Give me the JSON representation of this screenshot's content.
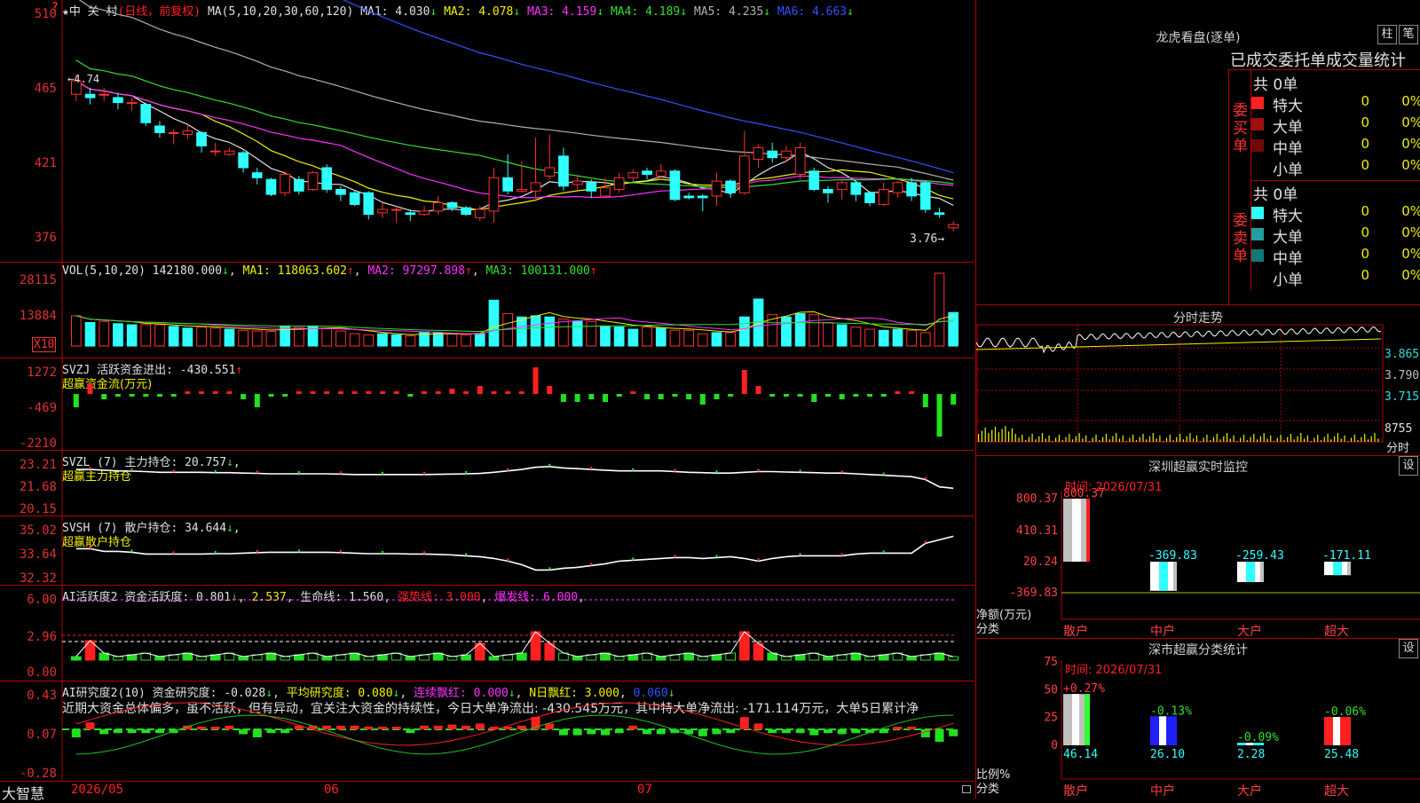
{
  "stock": {
    "title": "★中 关 村",
    "mode": "(日线，前复权)",
    "ma_label": "MA(5,10,20,30,60,120)",
    "ma": [
      {
        "label": "MA1: 4.030",
        "color": "#e0e0e0",
        "arrow": "↓"
      },
      {
        "label": "MA2: 4.078",
        "color": "#f0f000",
        "arrow": "↓"
      },
      {
        "label": "MA3: 4.159",
        "color": "#ff30ff",
        "arrow": "↓"
      },
      {
        "label": "MA4: 4.189",
        "color": "#30e030",
        "arrow": "↓"
      },
      {
        "label": "MA5: 4.235",
        "color": "#b0b0b0",
        "arrow": "↓"
      },
      {
        "label": "MA6: 4.663",
        "color": "#3050ff",
        "arrow": "↓"
      }
    ],
    "y_ticks": [
      "510",
      "465",
      "421",
      "376"
    ],
    "high_label": "4.74",
    "low_label": "3.76",
    "question": "?"
  },
  "vol": {
    "label": "VOL(5,10,20)",
    "value": "142180.000",
    "ma1": "MA1: 118063.602",
    "ma2": "MA2: 97297.898",
    "ma3": "MA3: 100131.000",
    "y_ticks": [
      "28115",
      "13884"
    ],
    "unit": "X10"
  },
  "svzj": {
    "label": "SVZJ",
    "desc": "活跃资金进出: -430.551",
    "sub": "超赢资金流(万元)",
    "y_ticks": [
      "1272",
      "-469",
      "-2210"
    ]
  },
  "svzl": {
    "label": "SVZL (7)",
    "desc": "主力持仓: 20.757",
    "sub": "超赢主力持仓",
    "y_ticks": [
      "23.21",
      "21.68",
      "20.15"
    ]
  },
  "svsh": {
    "label": "SVSH (7)",
    "desc": "散户持仓: 34.644",
    "sub": "超赢散户持仓",
    "y_ticks": [
      "35.02",
      "33.64",
      "32.32"
    ]
  },
  "ai1": {
    "label": "AI活跃度2",
    "v1": "资金活跃度: 0.801",
    "v2": "2.537",
    "v3": "生命线: 1.560",
    "v4": "强势线: 3.000",
    "v5": "爆发线: 6.000",
    "y_ticks": [
      "6.00",
      "2.96",
      "0.00"
    ]
  },
  "ai2": {
    "label": "AI研究度2(10)",
    "v1": "资金研究度: -0.028",
    "v2": "平均研究度: 0.080",
    "v3": "连续飘红: 0.000",
    "v4": "N日飘红: 3.000",
    "v5": "0.060",
    "commentary": "近期大资金总体偏多，虽不活跃，但有异动，宜关注大资金的持续性，今日大单净流出: -430.545万元，其中特大单净流出: -171.114万元，大单5日累计净",
    "y_ticks": [
      "0.43",
      "0.07",
      "-0.28"
    ]
  },
  "xaxis": {
    "app": "大智慧",
    "labels": [
      "2026/05",
      "06",
      "07"
    ]
  },
  "dragon": {
    "title": "龙虎看盘(逐单)",
    "btn1": "柱",
    "btn2": "笔",
    "subtitle": "已成交委托单成交量统计",
    "buy_label": "委买单",
    "sell_label": "委卖单",
    "buy_total": "共 0单",
    "sell_total": "共 0单",
    "buy_rows": [
      {
        "name": "特大",
        "count": "0",
        "pct": "0%",
        "color": "#ff2020"
      },
      {
        "name": "大单",
        "count": "0",
        "pct": "0%",
        "color": "#a01010"
      },
      {
        "name": "中单",
        "count": "0",
        "pct": "0%",
        "color": "#700808"
      },
      {
        "name": "小单",
        "count": "0",
        "pct": "0%",
        "color": ""
      }
    ],
    "sell_rows": [
      {
        "name": "特大",
        "count": "0",
        "pct": "0%",
        "color": "#30ffff"
      },
      {
        "name": "大单",
        "count": "0",
        "pct": "0%",
        "color": "#20a0a0"
      },
      {
        "name": "中单",
        "count": "0",
        "pct": "0%",
        "color": "#107878"
      },
      {
        "name": "小单",
        "count": "0",
        "pct": "0%",
        "color": ""
      }
    ]
  },
  "intraday": {
    "title": "分时走势",
    "y_ticks": [
      "3.865",
      "3.790",
      "3.715"
    ],
    "vol_tick": "8755",
    "vol_label": "分时"
  },
  "monitor": {
    "title": "深圳超赢实时监控",
    "btn": "设",
    "time": "时间: 2026/07/31",
    "y_ticks": [
      "800.37",
      "410.31",
      "20.24",
      "-369.83"
    ],
    "ylabel1": "净额(万元)",
    "ylabel2": "分类",
    "bars": [
      {
        "cat": "散户",
        "value": 800.37,
        "label": "800.37"
      },
      {
        "cat": "中户",
        "value": -369.83,
        "label": "-369.83"
      },
      {
        "cat": "大户",
        "value": -259.43,
        "label": "-259.43"
      },
      {
        "cat": "超大",
        "value": -171.11,
        "label": "-171.11"
      }
    ]
  },
  "classstat": {
    "title": "深市超赢分类统计",
    "btn": "设",
    "time": "时间: 2026/07/31",
    "y_ticks": [
      "75",
      "50",
      "25",
      "0"
    ],
    "ylabel1": "比例%",
    "ylabel2": "分类",
    "bars": [
      {
        "cat": "散户",
        "value": 46.14,
        "label": "46.14",
        "change": "+0.27%"
      },
      {
        "cat": "中户",
        "value": 26.1,
        "label": "26.10",
        "change": "-0.13%"
      },
      {
        "cat": "大户",
        "value": 2.28,
        "label": "2.28",
        "change": "-0.09%"
      },
      {
        "cat": "超大",
        "value": 25.48,
        "label": "25.48",
        "change": "-0.06%"
      }
    ]
  },
  "chart_data": {
    "type": "candlestick",
    "ylim": [
      3.76,
      5.1
    ],
    "candles": [
      [
        4.62,
        4.7,
        4.74,
        4.58
      ],
      [
        4.62,
        4.6,
        4.66,
        4.56
      ],
      [
        4.62,
        4.62,
        4.66,
        4.58
      ],
      [
        4.6,
        4.57,
        4.63,
        4.53
      ],
      [
        4.57,
        4.57,
        4.6,
        4.52
      ],
      [
        4.56,
        4.45,
        4.57,
        4.43
      ],
      [
        4.43,
        4.39,
        4.46,
        4.36
      ],
      [
        4.39,
        4.39,
        4.41,
        4.32
      ],
      [
        4.38,
        4.4,
        4.44,
        4.35
      ],
      [
        4.39,
        4.31,
        4.4,
        4.27
      ],
      [
        4.28,
        4.28,
        4.33,
        4.25
      ],
      [
        4.26,
        4.28,
        4.3,
        4.25
      ],
      [
        4.27,
        4.18,
        4.28,
        4.15
      ],
      [
        4.15,
        4.12,
        4.18,
        4.08
      ],
      [
        4.11,
        4.02,
        4.12,
        4.01
      ],
      [
        4.03,
        4.14,
        4.16,
        4.01
      ],
      [
        4.11,
        4.04,
        4.13,
        4.02
      ],
      [
        4.05,
        4.15,
        4.16,
        4.04
      ],
      [
        4.18,
        4.05,
        4.2,
        4.03
      ],
      [
        4.05,
        4.02,
        4.07,
        3.98
      ],
      [
        4.03,
        3.96,
        4.04,
        3.95
      ],
      [
        4.03,
        3.9,
        4.04,
        3.87
      ],
      [
        3.91,
        3.93,
        3.97,
        3.88
      ],
      [
        3.93,
        3.93,
        3.95,
        3.85
      ],
      [
        3.91,
        3.9,
        3.93,
        3.86
      ],
      [
        3.9,
        3.92,
        3.95,
        3.89
      ],
      [
        3.92,
        3.97,
        4.01,
        3.9
      ],
      [
        3.97,
        3.94,
        3.98,
        3.92
      ],
      [
        3.94,
        3.9,
        3.95,
        3.89
      ],
      [
        3.88,
        3.93,
        3.95,
        3.86
      ],
      [
        3.92,
        4.12,
        4.18,
        3.85
      ],
      [
        4.12,
        4.04,
        4.26,
        4.02
      ],
      [
        4.04,
        4.05,
        4.22,
        4.03
      ],
      [
        4.04,
        4.09,
        4.36,
        4.0
      ],
      [
        4.13,
        4.18,
        4.38,
        4.11
      ],
      [
        4.25,
        4.07,
        4.3,
        4.04
      ],
      [
        4.08,
        4.1,
        4.13,
        4.05
      ],
      [
        4.09,
        4.04,
        4.11,
        4.0
      ],
      [
        4.01,
        4.06,
        4.12,
        4.0
      ],
      [
        4.05,
        4.12,
        4.15,
        4.03
      ],
      [
        4.12,
        4.15,
        4.17,
        4.1
      ],
      [
        4.16,
        4.14,
        4.18,
        4.11
      ],
      [
        4.13,
        4.16,
        4.2,
        4.12
      ],
      [
        4.16,
        3.99,
        4.17,
        3.98
      ],
      [
        4.01,
        4.0,
        4.03,
        3.99
      ],
      [
        4.01,
        4.0,
        4.02,
        3.92
      ],
      [
        4.01,
        4.1,
        4.15,
        3.95
      ],
      [
        4.1,
        4.03,
        4.11,
        4.0
      ],
      [
        4.03,
        4.25,
        4.4,
        4.02
      ],
      [
        4.23,
        4.3,
        4.32,
        4.18
      ],
      [
        4.28,
        4.24,
        4.33,
        4.21
      ],
      [
        4.24,
        4.28,
        4.31,
        4.21
      ],
      [
        4.14,
        4.3,
        4.33,
        4.11
      ],
      [
        4.16,
        4.05,
        4.18,
        4.04
      ],
      [
        4.05,
        4.03,
        4.07,
        3.97
      ],
      [
        4.05,
        4.09,
        4.11,
        3.99
      ],
      [
        4.09,
        4.02,
        4.1,
        3.98
      ],
      [
        4.03,
        3.97,
        4.04,
        3.95
      ],
      [
        3.96,
        4.05,
        4.09,
        3.95
      ],
      [
        4.03,
        4.09,
        4.1,
        4.0
      ],
      [
        4.09,
        4.01,
        4.12,
        3.98
      ],
      [
        4.09,
        3.93,
        4.1,
        3.91
      ],
      [
        3.91,
        3.9,
        3.94,
        3.88
      ],
      [
        3.82,
        3.84,
        3.86,
        3.8
      ]
    ],
    "volume": [
      0.54,
      0.42,
      0.44,
      0.4,
      0.38,
      0.38,
      0.38,
      0.35,
      0.32,
      0.34,
      0.32,
      0.3,
      0.28,
      0.27,
      0.26,
      0.36,
      0.33,
      0.36,
      0.31,
      0.27,
      0.22,
      0.2,
      0.22,
      0.2,
      0.18,
      0.25,
      0.24,
      0.22,
      0.2,
      0.22,
      0.82,
      0.58,
      0.52,
      0.54,
      0.52,
      0.48,
      0.44,
      0.44,
      0.36,
      0.34,
      0.3,
      0.34,
      0.32,
      0.28,
      0.28,
      0.22,
      0.24,
      0.24,
      0.52,
      0.84,
      0.56,
      0.52,
      0.58,
      0.56,
      0.42,
      0.38,
      0.34,
      0.3,
      0.28,
      0.3,
      0.28,
      0.24,
      1.3,
      0.6
    ],
    "vol_up": [
      true,
      false,
      true,
      false,
      false,
      true,
      true,
      false,
      false,
      true,
      true,
      false,
      true,
      true,
      true,
      false,
      true,
      false,
      true,
      true,
      true,
      true,
      false,
      false,
      true,
      false,
      false,
      true,
      true,
      false,
      false,
      true,
      false,
      false,
      false,
      true,
      false,
      true,
      false,
      false,
      false,
      true,
      false,
      true,
      true,
      true,
      false,
      true,
      false,
      false,
      true,
      false,
      false,
      true,
      true,
      false,
      true,
      true,
      false,
      false,
      true,
      true,
      true,
      false
    ],
    "svzj": [
      -0.5,
      0.4,
      -0.2,
      -0.1,
      -0.1,
      -0.1,
      -0.1,
      -0.1,
      0.1,
      0.0,
      0.0,
      0.1,
      -0.2,
      -0.5,
      -0.1,
      -0.1,
      0.1,
      0.1,
      0.1,
      0.1,
      0.1,
      0.0,
      0.0,
      0.0,
      -0.1,
      0.1,
      0.1,
      0.2,
      0.1,
      0.3,
      0.0,
      0.0,
      0.1,
      1.0,
      0.3,
      -0.3,
      -0.3,
      -0.2,
      -0.3,
      -0.1,
      0.1,
      -0.2,
      -0.2,
      -0.1,
      -0.2,
      -0.4,
      -0.2,
      -0.1,
      0.9,
      0.3,
      -0.1,
      -0.1,
      -0.1,
      -0.3,
      -0.1,
      -0.2,
      -0.1,
      -0.1,
      -0.1,
      0.0,
      0.0,
      -0.5,
      -1.6,
      -0.4
    ],
    "svzl": [
      22.9,
      22.9,
      22.85,
      22.8,
      22.78,
      22.75,
      22.7,
      22.7,
      22.7,
      22.7,
      22.68,
      22.68,
      22.65,
      22.63,
      22.6,
      22.6,
      22.6,
      22.6,
      22.6,
      22.58,
      22.55,
      22.55,
      22.55,
      22.55,
      22.55,
      22.55,
      22.56,
      22.58,
      22.6,
      22.62,
      22.7,
      22.8,
      22.9,
      23.05,
      23.1,
      23.0,
      22.95,
      22.9,
      22.85,
      22.8,
      22.8,
      22.8,
      22.8,
      22.75,
      22.7,
      22.68,
      22.65,
      22.65,
      22.7,
      22.75,
      22.75,
      22.72,
      22.7,
      22.68,
      22.65,
      22.65,
      22.6,
      22.55,
      22.5,
      22.45,
      22.4,
      22.2,
      21.7,
      21.6
    ],
    "svsh": [
      34.0,
      34.0,
      33.85,
      33.85,
      33.8,
      33.7,
      33.7,
      33.7,
      33.7,
      33.7,
      33.72,
      33.72,
      33.75,
      33.78,
      33.8,
      33.8,
      33.8,
      33.8,
      33.8,
      33.78,
      33.75,
      33.72,
      33.72,
      33.72,
      33.7,
      33.7,
      33.68,
      33.65,
      33.6,
      33.55,
      33.45,
      33.3,
      33.1,
      32.8,
      32.8,
      32.9,
      32.95,
      33.05,
      33.15,
      33.3,
      33.35,
      33.4,
      33.45,
      33.5,
      33.5,
      33.45,
      33.5,
      33.55,
      33.45,
      33.3,
      33.45,
      33.55,
      33.6,
      33.6,
      33.6,
      33.6,
      33.7,
      33.75,
      33.75,
      33.75,
      33.75,
      34.3,
      34.5,
      34.7
    ]
  }
}
